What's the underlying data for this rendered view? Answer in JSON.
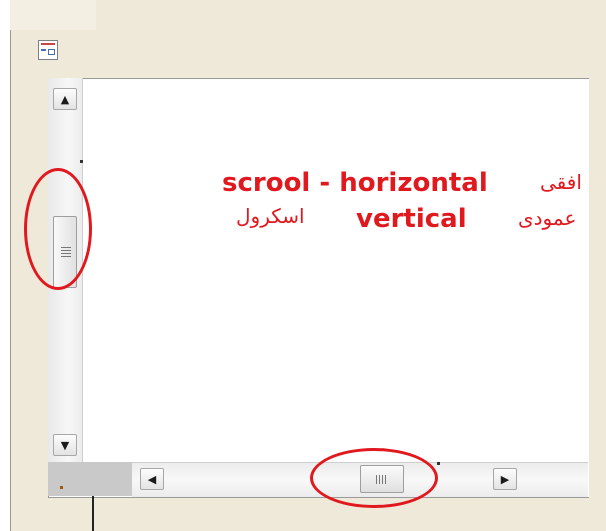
{
  "window": {
    "icon": "form-icon"
  },
  "scrollbars": {
    "vertical": {
      "up_arrow": "▲",
      "down_arrow": "▼"
    },
    "horizontal": {
      "left_arrow": "◀",
      "right_arrow": "▶"
    }
  },
  "annotation": {
    "color": "#e0191e",
    "arabic_horizontal": "افقی",
    "english_line1": "scrool - horizontal",
    "english_line2": "vertical",
    "arabic_vertical": "عمودی",
    "arabic_scroll": "اسکرول"
  }
}
